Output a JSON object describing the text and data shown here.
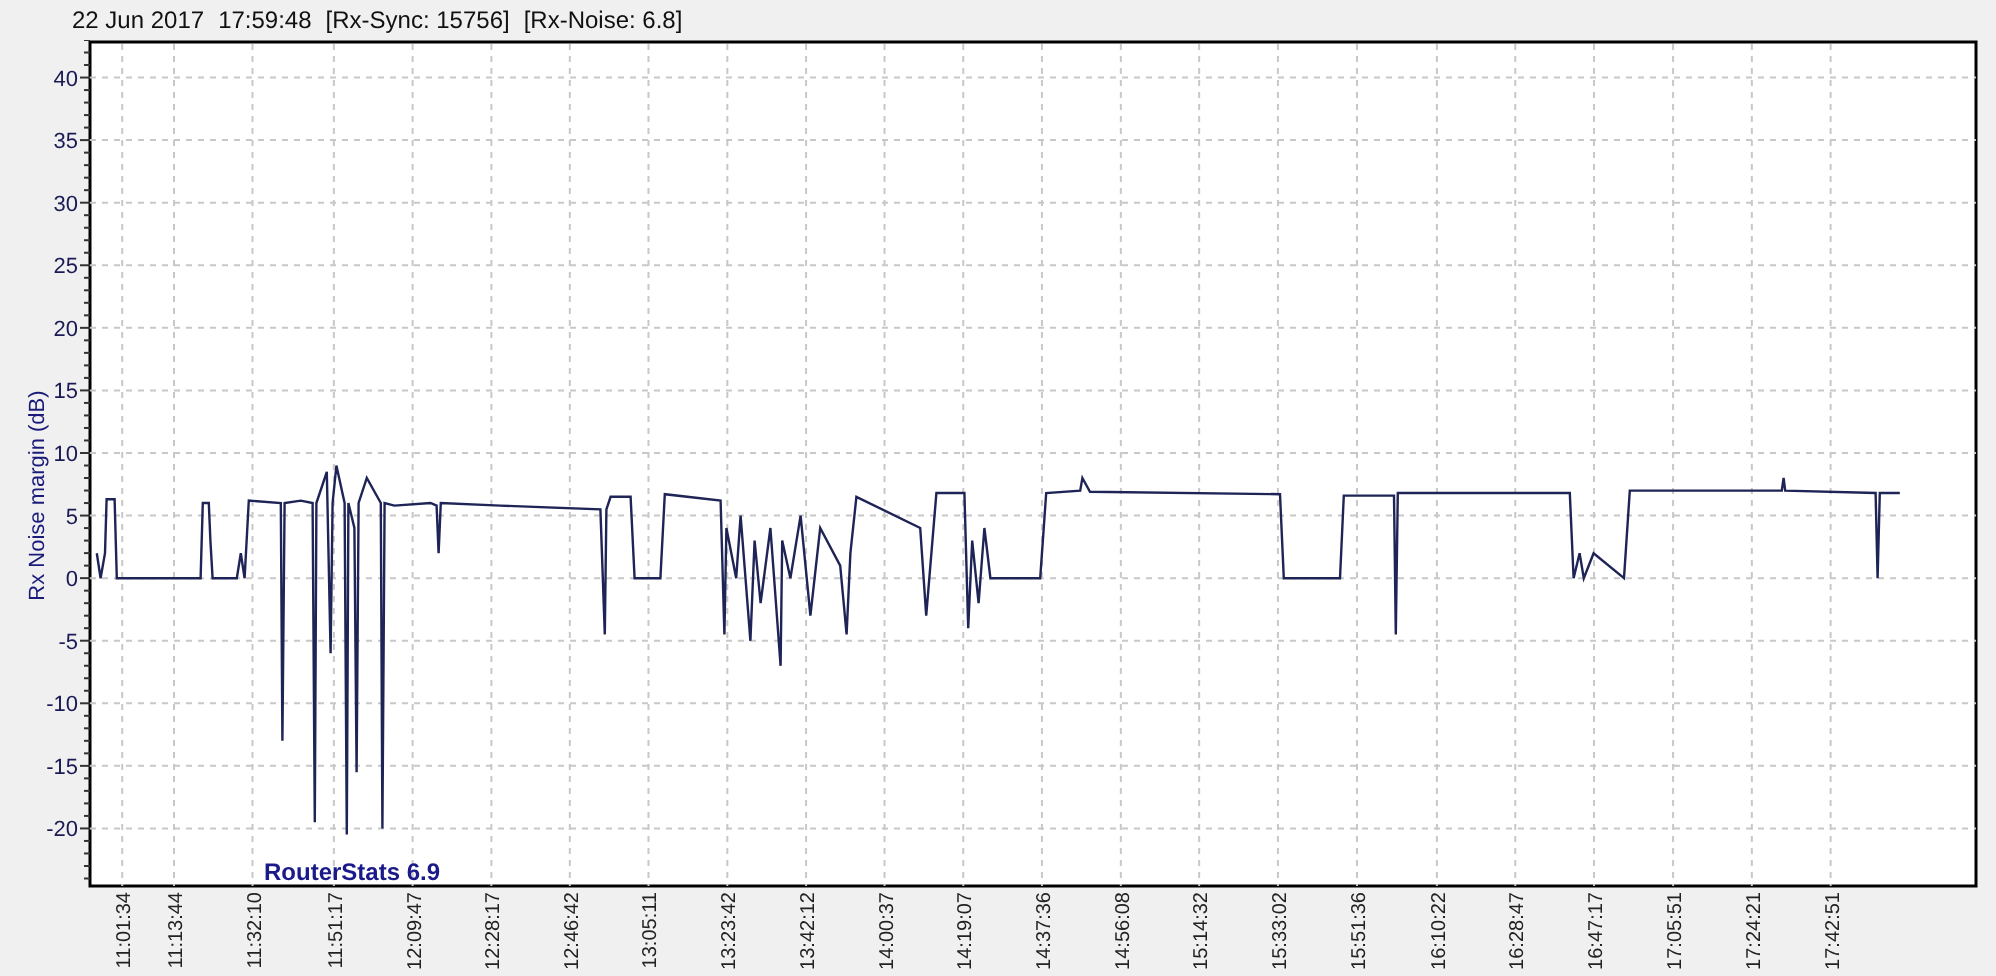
{
  "header": [
    "22 Jun 2017",
    "17:59:48",
    "[Rx-Sync: 15756]",
    "[Rx-Noise: 6.8]"
  ],
  "app_label": "RouterStats 6.9",
  "chart_data": {
    "type": "line",
    "ylabel": "Rx Noise margin (dB)",
    "x": [
      655.6,
      656.5,
      657.5,
      657.9,
      659.8,
      660.3,
      680.0,
      680.5,
      681.9,
      682.3,
      682.8,
      688.5,
      689.4,
      690.3,
      691.3,
      698.8,
      699.2,
      699.7,
      703.5,
      706.3,
      706.8,
      707.2,
      709.6,
      710.5,
      711.0,
      711.9,
      713.8,
      714.3,
      714.7,
      716.1,
      716.6,
      717.1,
      719.0,
      722.3,
      722.7,
      723.2,
      725.5,
      734.0,
      735.4,
      735.9,
      736.4,
      750.4,
      773.9,
      774.9,
      775.3,
      776.3,
      781.0,
      781.9,
      788.0,
      789.0,
      802.1,
      803.0,
      803.5,
      805.8,
      806.8,
      809.1,
      810.1,
      811.5,
      813.8,
      816.2,
      816.6,
      818.5,
      820.9,
      823.2,
      825.5,
      830.2,
      831.7,
      832.6,
      834.0,
      849.0,
      850.4,
      852.8,
      859.4,
      860.3,
      861.2,
      862.7,
      864.1,
      865.5,
      877.2,
      878.6,
      886.6,
      887.1,
      888.9,
      933.5,
      934.4,
      947.6,
      948.5,
      960.3,
      960.7,
      961.2,
      1001.6,
      1002.5,
      1003.9,
      1004.9,
      1007.2,
      1014.3,
      1015.7,
      1051.4,
      1051.8,
      1052.2,
      1073.4,
      1073.9,
      1074.4,
      1079.1
    ],
    "grid": true,
    "series": [
      {
        "color": "#1f2456",
        "values": [
          2,
          0,
          2,
          6.3,
          6.3,
          0,
          0,
          6,
          6,
          3,
          0,
          0,
          2,
          0,
          6.2,
          6,
          -13,
          6,
          6.2,
          6,
          -19.5,
          6,
          8.5,
          -6,
          6,
          9,
          6,
          -20.5,
          6,
          4,
          -15.5,
          6,
          8,
          6,
          -20,
          6,
          5.8,
          6,
          5.8,
          2,
          6,
          5.8,
          5.5,
          -4.5,
          5.5,
          6.5,
          6.5,
          0,
          0,
          6.7,
          6.2,
          -4.5,
          4,
          0,
          5,
          -5,
          3,
          -2,
          4,
          -7,
          3,
          0,
          5,
          -3,
          4,
          1,
          -4.5,
          2,
          6.5,
          4,
          -3,
          6.8,
          6.8,
          -4,
          3,
          -2,
          4,
          0,
          0,
          6.8,
          7,
          8,
          6.9,
          6.7,
          0,
          0,
          6.6,
          6.6,
          -4.5,
          6.8,
          6.8,
          0,
          2,
          0,
          2,
          0,
          7,
          7,
          8,
          7,
          6.8,
          0,
          6.8,
          6.8
        ]
      }
    ],
    "xlim": [
      654,
      1097
    ],
    "ylim": [
      -24.6,
      43
    ],
    "xticks": [
      {
        "value": 661.57,
        "label": "11:01:34"
      },
      {
        "value": 673.73,
        "label": "11:13:44"
      },
      {
        "value": 692.17,
        "label": "11:32:10"
      },
      {
        "value": 711.28,
        "label": "11:51:17"
      },
      {
        "value": 729.78,
        "label": "12:09:47"
      },
      {
        "value": 748.28,
        "label": "12:28:17"
      },
      {
        "value": 766.7,
        "label": "12:46:42"
      },
      {
        "value": 785.18,
        "label": "13:05:11"
      },
      {
        "value": 803.7,
        "label": "13:23:42"
      },
      {
        "value": 822.2,
        "label": "13:42:12"
      },
      {
        "value": 840.62,
        "label": "14:00:37"
      },
      {
        "value": 859.12,
        "label": "14:19:07"
      },
      {
        "value": 877.6,
        "label": "14:37:36"
      },
      {
        "value": 896.13,
        "label": "14:56:08"
      },
      {
        "value": 914.53,
        "label": "15:14:32"
      },
      {
        "value": 933.03,
        "label": "15:33:02"
      },
      {
        "value": 951.6,
        "label": "15:51:36"
      },
      {
        "value": 970.37,
        "label": "16:10:22"
      },
      {
        "value": 988.78,
        "label": "16:28:47"
      },
      {
        "value": 1007.28,
        "label": "16:47:17"
      },
      {
        "value": 1025.85,
        "label": "17:05:51"
      },
      {
        "value": 1044.35,
        "label": "17:24:21"
      },
      {
        "value": 1062.85,
        "label": "17:42:51"
      }
    ],
    "yticks": [
      -20,
      -15,
      -10,
      -5,
      0,
      5,
      10,
      15,
      20,
      25,
      30,
      35,
      40
    ]
  }
}
